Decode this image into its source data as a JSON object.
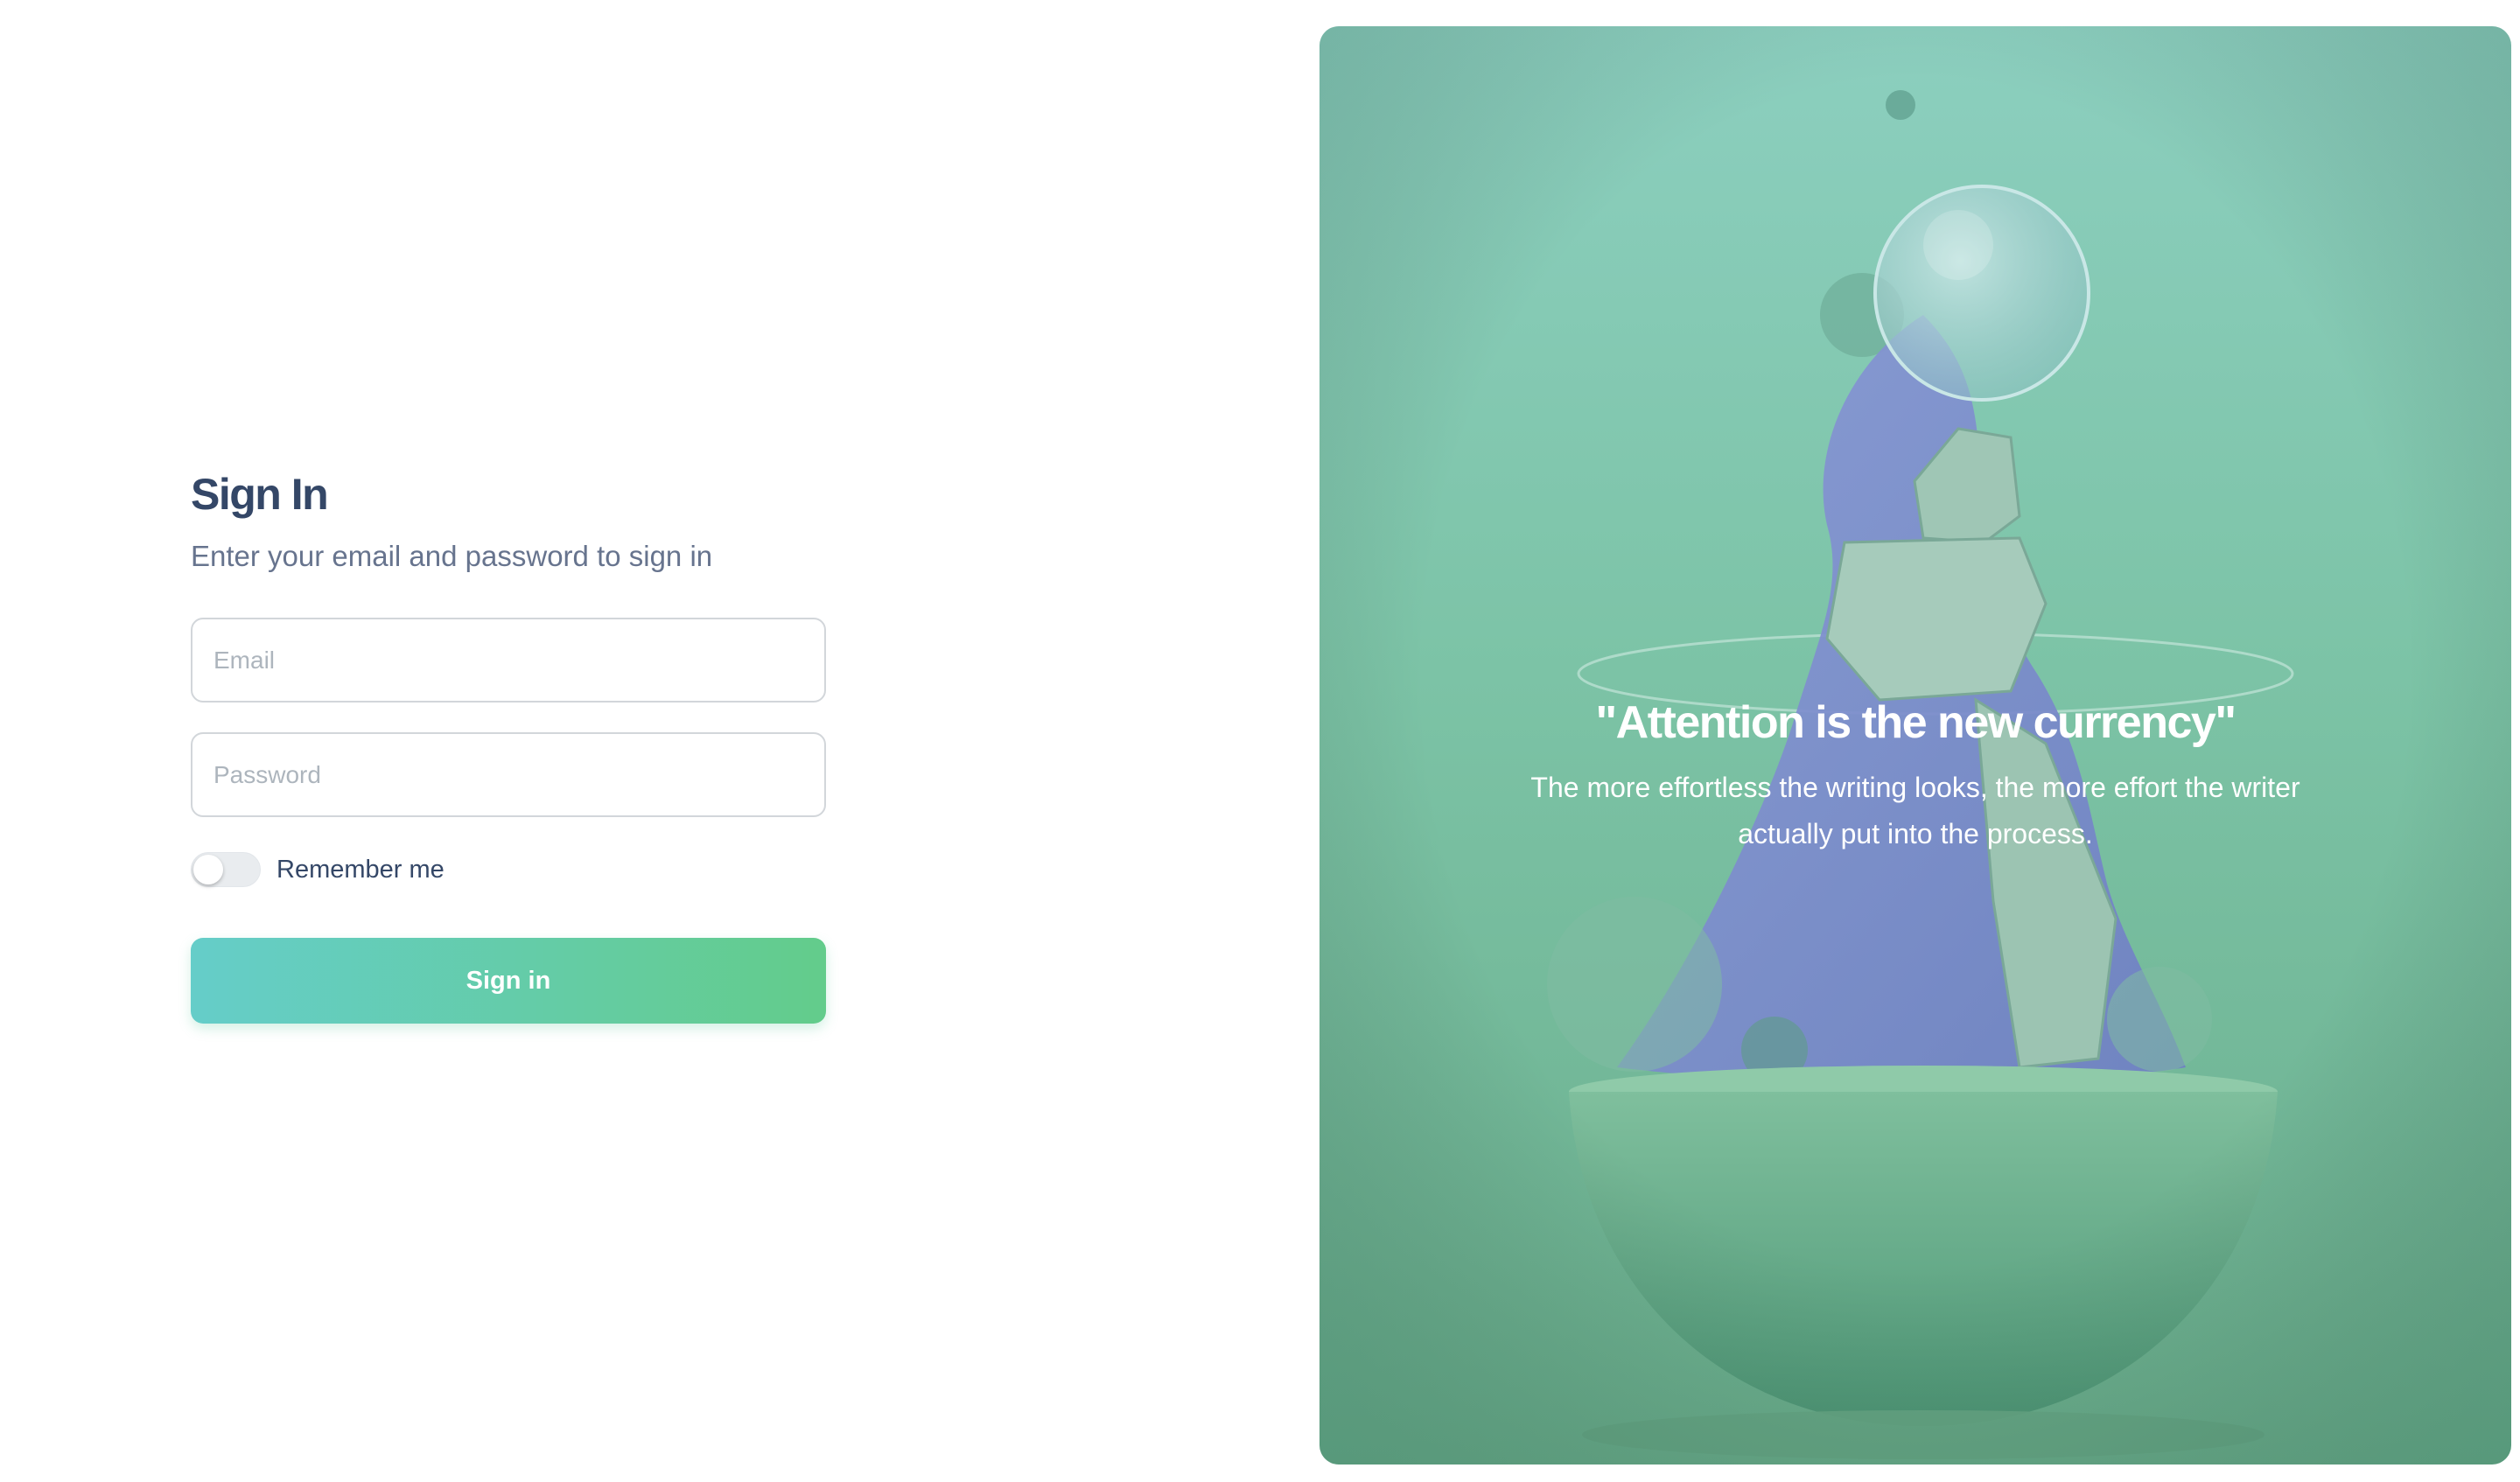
{
  "signin": {
    "title": "Sign In",
    "subtitle": "Enter your email and password to sign in",
    "email_placeholder": "Email",
    "password_placeholder": "Password",
    "remember_label": "Remember me",
    "remember_checked": false,
    "submit_label": "Sign in"
  },
  "hero": {
    "quote": "\"Attention is the new currency\"",
    "subtext": "The more effortless the writing looks, the more effort the writer actually put into the process."
  },
  "colors": {
    "heading": "#344767",
    "muted_text": "#67748e",
    "input_border": "#d2d6da",
    "button_gradient_start": "#65cdc9",
    "button_gradient_end": "#63cc8b",
    "hero_overlay": "#7cc3a6"
  }
}
